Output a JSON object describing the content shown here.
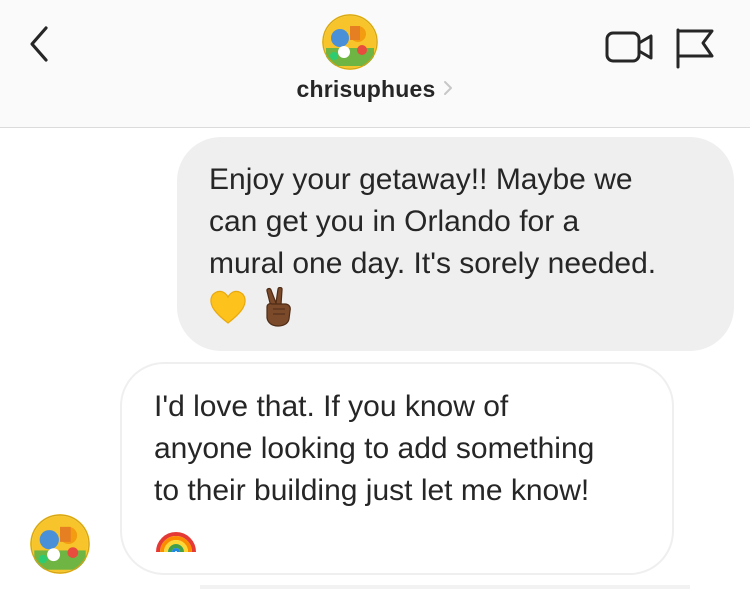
{
  "header": {
    "username": "chrisuphues"
  },
  "icons": {
    "back": "chevron-left-icon",
    "video": "video-camera-icon",
    "report": "flag-icon",
    "username_chevron": "chevron-right-icon"
  },
  "messages": [
    {
      "direction": "sent",
      "lines": [
        "Enjoy your getaway!! Maybe we",
        "can get you in Orlando for a",
        "mural one day. It's sorely needed."
      ],
      "emoji": [
        "yellow-heart",
        "victory-hand-dark-skin"
      ]
    },
    {
      "direction": "received",
      "lines": [
        "I'd love that. If you know of",
        "anyone looking to add something",
        "to their building just let me know!"
      ],
      "emoji": [
        "rainbow"
      ]
    }
  ],
  "colors": {
    "header_bg": "#fafafa",
    "divider": "#dbdbdb",
    "sent_bubble": "#efefef",
    "received_border": "#efefef",
    "text": "#262626",
    "icon": "#262626"
  }
}
